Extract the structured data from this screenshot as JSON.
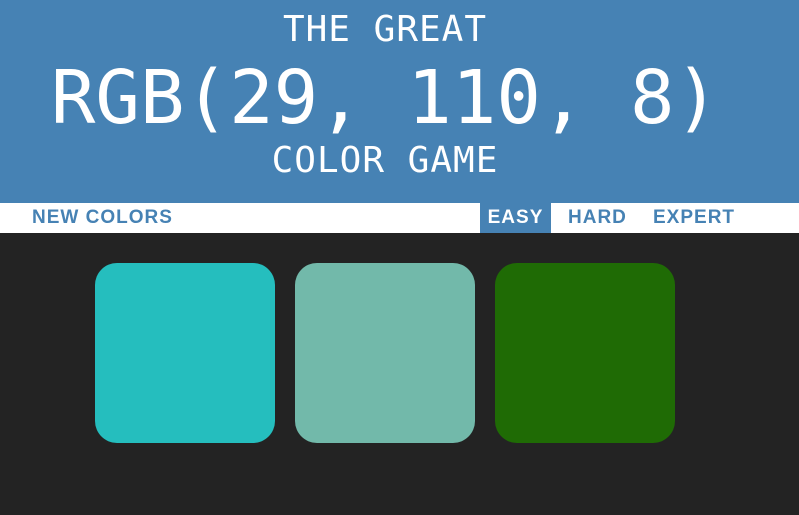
{
  "header": {
    "line1": "THE GREAT",
    "target_rgb": "RGB(29, 110, 8)",
    "line3": "COLOR GAME"
  },
  "controls": {
    "new_colors": "NEW COLORS",
    "modes": [
      "EASY",
      "HARD",
      "EXPERT"
    ],
    "selected_mode": "EASY"
  },
  "squares": [
    {
      "color": "#25bebe"
    },
    {
      "color": "#72b9aa"
    },
    {
      "color": "#1f6b05"
    }
  ],
  "colors": {
    "header_bg": "#4682b4",
    "page_bg": "#232323",
    "stripe_bg": "#ffffff",
    "accent_text": "#4682b4"
  }
}
